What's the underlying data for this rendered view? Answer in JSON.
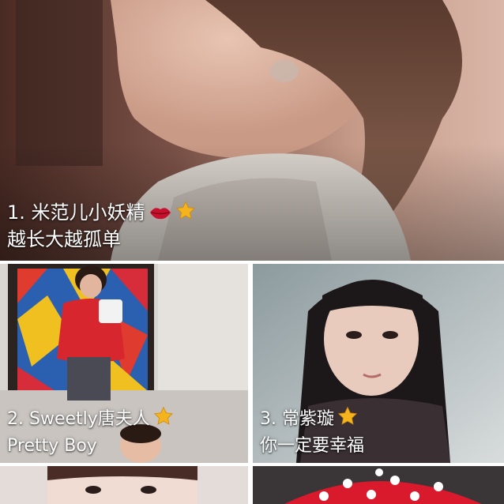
{
  "feed": {
    "featured": {
      "name": "1. 米范儿小妖精",
      "bio": "越长大越孤单",
      "icons": [
        "lips-icon",
        "star-icon"
      ]
    },
    "grid": [
      {
        "name": "2. Sweetly唐夫人",
        "bio": "Pretty Boy",
        "icons": [
          "star-icon"
        ]
      },
      {
        "name": "3. 常紫璇",
        "bio": "你一定要幸福",
        "icons": [
          "star-icon"
        ]
      },
      {
        "name": "",
        "bio": "",
        "icons": []
      },
      {
        "name": "",
        "bio": "",
        "icons": []
      }
    ]
  },
  "colors": {
    "background": "#ffffff",
    "caption_text": "#ffffff",
    "star": "#f5b41e",
    "lips": "#c8102e"
  }
}
